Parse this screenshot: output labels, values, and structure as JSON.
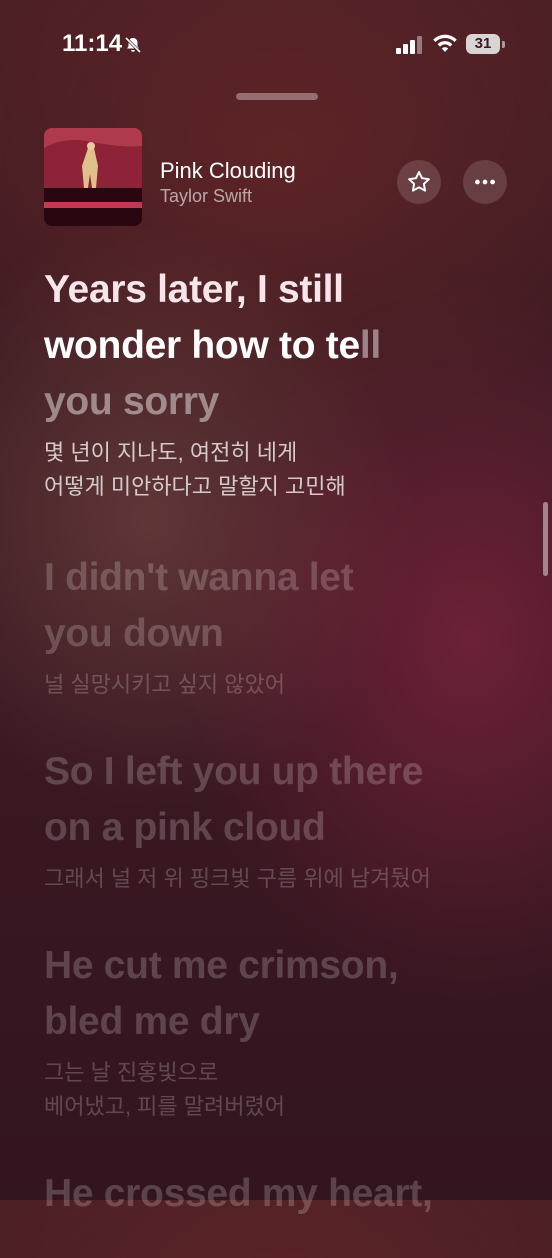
{
  "status_bar": {
    "time": "11:14",
    "battery": "31"
  },
  "now_playing": {
    "title": "Pink Clouding",
    "artist": "Taylor Swift"
  },
  "lyrics": [
    {
      "lines": [
        "Years later, I still",
        "wonder how to te",
        "ll",
        "you sorry"
      ],
      "translation": [
        "몇 년이 지나도, 여전히 네게",
        "어떻게 미안하다고 말할지 고민해"
      ]
    },
    {
      "lines": [
        "I didn't wanna let",
        "you down"
      ],
      "translation": [
        "널 실망시키고 싶지 않았어"
      ]
    },
    {
      "lines": [
        "So I left you up there",
        "on a pink cloud"
      ],
      "translation": [
        "그래서 널 저 위 핑크빛 구름 위에 남겨뒀어"
      ]
    },
    {
      "lines": [
        "He cut me crimson,",
        "bled me dry"
      ],
      "translation": [
        "그는 날 진홍빛으로",
        "베어냈고, 피를 말려버렸어"
      ]
    },
    {
      "lines": [
        "He crossed my heart,"
      ],
      "translation": []
    }
  ]
}
